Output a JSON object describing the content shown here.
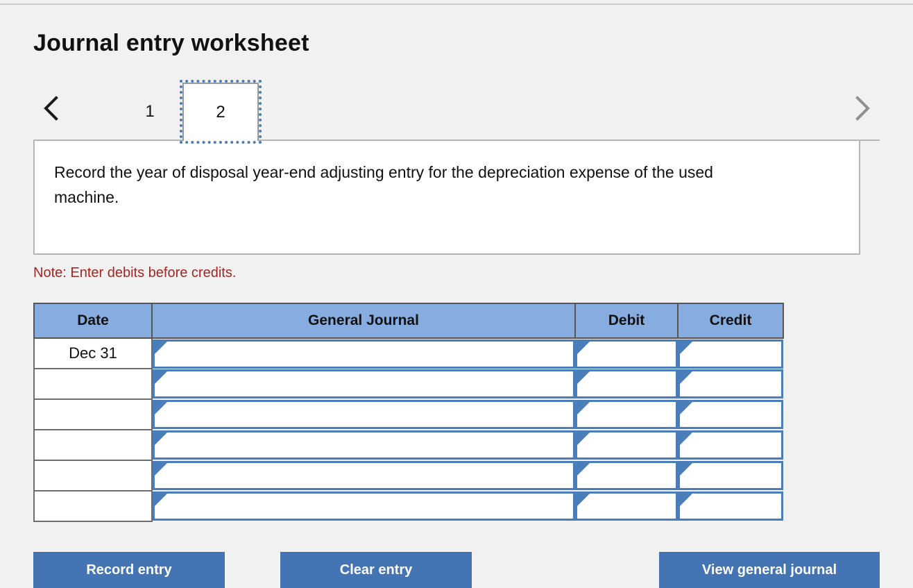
{
  "page_title": "Journal entry worksheet",
  "tabs": {
    "prev_icon": "chevron-left-icon",
    "next_icon": "chevron-right-icon",
    "items": [
      {
        "label": "1",
        "active": false
      },
      {
        "label": "2",
        "active": true
      }
    ]
  },
  "instruction": {
    "text": "Record the year of disposal year-end adjusting entry for the depreciation expense of the used machine."
  },
  "note": {
    "text": "Note: Enter debits before credits."
  },
  "table": {
    "headers": [
      "Date",
      "General Journal",
      "Debit",
      "Credit"
    ],
    "rows": [
      {
        "date": "Dec 31",
        "general_journal": "",
        "debit": "",
        "credit": ""
      },
      {
        "date": "",
        "general_journal": "",
        "debit": "",
        "credit": ""
      },
      {
        "date": "",
        "general_journal": "",
        "debit": "",
        "credit": ""
      },
      {
        "date": "",
        "general_journal": "",
        "debit": "",
        "credit": ""
      },
      {
        "date": "",
        "general_journal": "",
        "debit": "",
        "credit": ""
      },
      {
        "date": "",
        "general_journal": "",
        "debit": "",
        "credit": ""
      }
    ]
  },
  "buttons": {
    "record_entry": "Record entry",
    "clear_entry": "Clear entry",
    "view_general_journal": "View general journal"
  },
  "colors": {
    "header_blue": "#86ace0",
    "button_blue": "#4474b4",
    "field_border_blue": "#4a7ebb",
    "note_red": "#a32622",
    "page_background": "#f1f1f1"
  }
}
